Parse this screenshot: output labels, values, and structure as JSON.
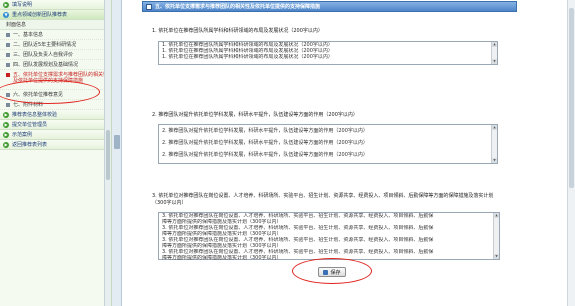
{
  "sidebar": {
    "top_items": [
      {
        "label": "填写说明",
        "icon": "arrow-right-icon"
      },
      {
        "label": "重点领域创新团队推荐表",
        "icon": "arrow-down-icon"
      }
    ],
    "form_heading": "封面信息",
    "sub_items": [
      {
        "label": "一、基本信息"
      },
      {
        "label": "二、团队近5年主要科研情况"
      },
      {
        "label": "三、团队及负责人自我评价"
      },
      {
        "label": "四、团队发展规划及基础情况"
      },
      {
        "label": "五、依托单位支撑需求与推荐团队的相关性及依托单位提供的支持保障措施"
      },
      {
        "label": "六、依托单位推荐意见"
      },
      {
        "label": "七、附件材料"
      }
    ],
    "bottom_items": [
      {
        "label": "推荐表信息整体校验",
        "icon": "arrow-right-icon"
      },
      {
        "label": "提交单位管理员",
        "icon": "arrow-right-icon"
      },
      {
        "label": "示范案例",
        "icon": "arrow-right-icon"
      },
      {
        "label": "返回推荐表列表",
        "icon": "arrow-right-icon"
      }
    ]
  },
  "main": {
    "title": "五、依托单位支撑需求与推荐团队的相关性及依托单位提供的支持保障措施",
    "q1": {
      "label": "1. 依托单位在推荐团队所属学科和科研领域的布局及发展状况（200字以内）",
      "lines": [
        "1. 依托单位在推荐团队所属学科和科研领域的布局及发展状况（200字以内）",
        "1. 依托单位在推荐团队所属学科和科研领域的布局及发展状况（200字以内）",
        "1. 依托单位在推荐团队所属学科和科研领域的布局及发展状况（200字以内）"
      ]
    },
    "q2": {
      "label": "2. 推荐团队对提升依托单位学科发展，科研水平提升，队伍建设等方面的作用（200字以内）",
      "lines": [
        "2. 推荐团队对提升依托单位学科发展，科研水平提升，队伍建设等方面的作用（200字以内）",
        "2. 推荐团队对提升依托单位学科发展，科研水平提升，队伍建设等方面的作用（200字以内）",
        "2. 推荐团队对提升依托单位学科发展，科研水平提升，队伍建设等方面的作用（200字以内）"
      ]
    },
    "q3": {
      "label_line1": "3. 依托单位对推荐团队在岗位设置、人才培养、科研场所、实验平台、招生计划、资源共享、经费投入、项目倾斜、后勤保障等方面的保障措施及落实计划（300字以内）",
      "lines": [
        "3. 依托单位对推荐团队在岗位设置、人才培养、科研场所、实验平台、招生计划、资源共享、经费投入、项目倾斜、后勤保",
        "障等方面所提供的保障措施及落实计划（300字以内）",
        "3. 依托单位对推荐团队在岗位设置、人才培养、科研场所、实验平台、招生计划、资源共享、经费投入、项目倾斜、后勤保",
        "障等方面所提供的保障措施及落实计划（300字以内）",
        "3. 依托单位对推荐团队在岗位设置、人才培养、科研场所、实验平台、招生计划、资源共享、经费投入、项目倾斜、后勤保",
        "障等方面所提供的保障措施及落实计划（300字以内）",
        "3. 依托单位对推荐团队在岗位设置、人才培养、科研场所、实验平台、招生计划、资源共享、经费投入、项目倾斜、后勤保",
        "障等方面所提供的保障措施及落实计划（300字以内）"
      ]
    },
    "save_label": "保存",
    "save_icon": "floppy-disk-icon"
  },
  "colors": {
    "title_bar": "#4f86c9",
    "highlight_red": "#c81f1f",
    "sidebar_green": "#3d9a2e"
  }
}
